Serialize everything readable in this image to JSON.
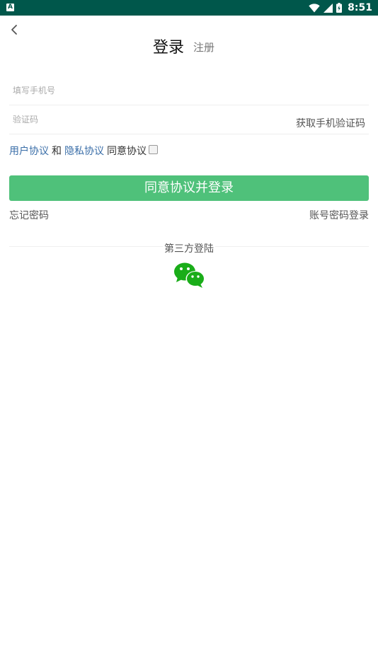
{
  "status_bar": {
    "time": "8:51",
    "app_icon_letter": "A"
  },
  "header": {
    "login_title": "登录",
    "register_tab": "注册"
  },
  "form": {
    "phone_placeholder": "填写手机号",
    "code_placeholder": "验证码",
    "get_code_label": "获取手机验证码"
  },
  "agreement": {
    "user_agreement": "用户协议",
    "and_text": "和",
    "privacy_agreement": "隐私协议",
    "agree_text": "同意协议",
    "checked": false
  },
  "actions": {
    "login_button": "同意协议并登录",
    "forgot_password": "忘记密码",
    "password_login": "账号密码登录"
  },
  "third_party": {
    "label": "第三方登陆",
    "icon": "wechat-icon"
  },
  "colors": {
    "status_bar": "#00574b",
    "primary_button": "#4fc17a",
    "link": "#3a6ea8",
    "wechat": "#1aad19"
  }
}
